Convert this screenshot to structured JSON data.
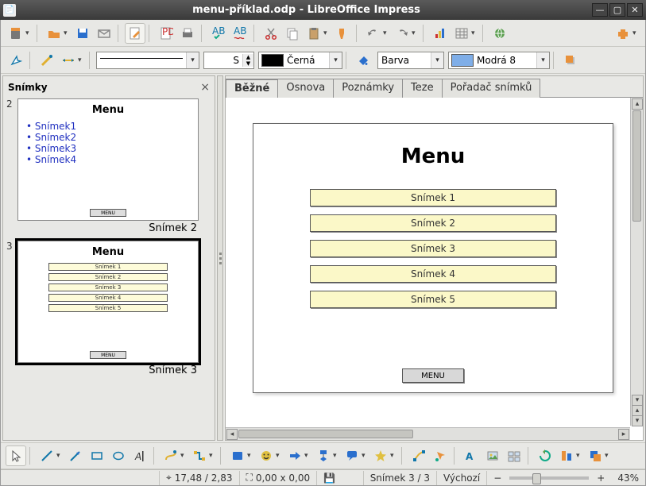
{
  "titlebar": {
    "title": "menu-příklad.odp - LibreOffice Impress"
  },
  "toolbar2": {
    "line_style_value": "S",
    "color_name": "Černá",
    "fill_mode": "Barva",
    "fill_color_name": "Modrá 8",
    "color_swatch": "#000000",
    "fill_swatch": "#7faee8"
  },
  "panel": {
    "title": "Snímky"
  },
  "thumbs": [
    {
      "num": "2",
      "title": "Menu",
      "bullets": [
        "Snímek1",
        "Snímek2",
        "Snímek3",
        "Snímek4"
      ],
      "label": "Snímek 2",
      "has_btns": false,
      "sel": false,
      "menubtn": "MENU"
    },
    {
      "num": "3",
      "title": "Menu",
      "buttons": [
        "Snímek 1",
        "Snímek 2",
        "Snímek 3",
        "Snímek 4",
        "Snímek 5"
      ],
      "label": "Snímek 3",
      "has_btns": true,
      "sel": true,
      "menubtn": "MENU"
    }
  ],
  "tabs": [
    "Běžné",
    "Osnova",
    "Poznámky",
    "Teze",
    "Pořadač snímků"
  ],
  "active_tab": 0,
  "slide": {
    "title": "Menu",
    "buttons": [
      "Snímek 1",
      "Snímek 2",
      "Snímek 3",
      "Snímek 4",
      "Snímek 5"
    ],
    "menu_btn": "MENU"
  },
  "status": {
    "pos": "17,48 / 2,83",
    "size": "0,00 x 0,00",
    "slide_info": "Snímek 3 / 3",
    "layout": "Výchozí",
    "zoom": "43%"
  }
}
